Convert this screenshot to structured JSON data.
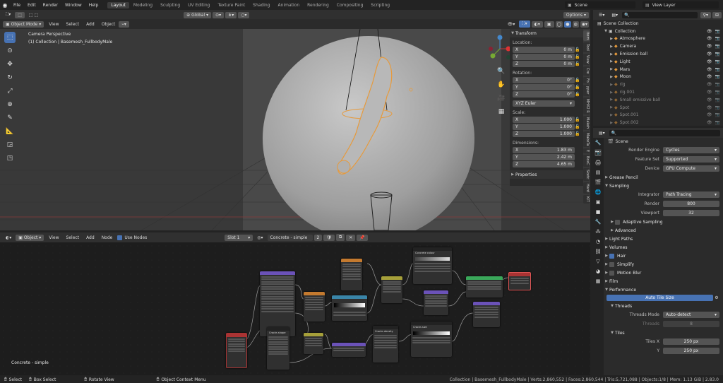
{
  "topbar": {
    "menus": [
      "File",
      "Edit",
      "Render",
      "Window",
      "Help"
    ],
    "workspaces": [
      "Layout",
      "Modeling",
      "Sculpting",
      "UV Editing",
      "Texture Paint",
      "Shading",
      "Animation",
      "Rendering",
      "Compositing",
      "Scripting"
    ],
    "active_workspace": "Layout",
    "scene": "Scene",
    "view_layer": "View Layer"
  },
  "viewport": {
    "mode": "Object Mode",
    "menus": [
      "View",
      "Select",
      "Add",
      "Object"
    ],
    "transform_orientation": "Global",
    "options": "Options",
    "overlay_title": "Camera Perspective",
    "overlay_sub": "(1) Collection | Basemesh_FullbodyMale"
  },
  "npanel": {
    "tab_header": "Transform",
    "location_label": "Location:",
    "rotation_label": "Rotation:",
    "scale_label": "Scale:",
    "dimensions_label": "Dimensions:",
    "location": [
      {
        "axis": "X",
        "value": "0 m"
      },
      {
        "axis": "Y",
        "value": "0 m"
      },
      {
        "axis": "Z",
        "value": "0 m"
      }
    ],
    "rotation": [
      {
        "axis": "X",
        "value": "0°"
      },
      {
        "axis": "Y",
        "value": "0°"
      },
      {
        "axis": "Z",
        "value": "0°"
      }
    ],
    "rotation_mode": "XYZ Euler",
    "scale": [
      {
        "axis": "X",
        "value": "1.000"
      },
      {
        "axis": "Y",
        "value": "1.000"
      },
      {
        "axis": "Z",
        "value": "1.000"
      }
    ],
    "dimensions": [
      {
        "axis": "X",
        "value": "1.83 m"
      },
      {
        "axis": "Y",
        "value": "2.42 m"
      },
      {
        "axis": "Z",
        "value": "4.65 m"
      }
    ],
    "properties": "Properties",
    "tabs": [
      "Item",
      "Tool",
      "View",
      "Cre",
      "Fo",
      "pper",
      "MHX2 R",
      "Makeh",
      "MakeTa",
      "E",
      "BoxC",
      "Sketc",
      "Hard",
      "KIT"
    ]
  },
  "node_editor": {
    "editor": "Object",
    "menus": [
      "View",
      "Select",
      "Add",
      "Node"
    ],
    "use_nodes": "Use Nodes",
    "slot": "Slot 1",
    "material": "Concrete - simple",
    "users": "2",
    "footer_label": "Concrete - simple",
    "node_titles": [
      "Concrete colour",
      "Cracks shape",
      "Cracks density",
      "Cracks size"
    ]
  },
  "outliner": {
    "root": "Scene Collection",
    "items": [
      {
        "name": "Collection",
        "color": "#c9c9c9",
        "dim": false
      },
      {
        "name": "Atmosphere",
        "color": "#e69a3c",
        "dim": false
      },
      {
        "name": "Camera",
        "color": "#e69a3c",
        "dim": false
      },
      {
        "name": "Emission ball",
        "color": "#e69a3c",
        "dim": false
      },
      {
        "name": "Light",
        "color": "#e69a3c",
        "dim": false
      },
      {
        "name": "Mars",
        "color": "#e69a3c",
        "dim": false
      },
      {
        "name": "Moon",
        "color": "#e69a3c",
        "dim": false
      },
      {
        "name": "rig",
        "color": "#e69a3c",
        "dim": true
      },
      {
        "name": "rig.001",
        "color": "#e69a3c",
        "dim": true
      },
      {
        "name": "Small emissive ball",
        "color": "#e69a3c",
        "dim": true
      },
      {
        "name": "Spot",
        "color": "#e69a3c",
        "dim": true
      },
      {
        "name": "Spot.001",
        "color": "#e69a3c",
        "dim": true
      },
      {
        "name": "Spot.002",
        "color": "#e69a3c",
        "dim": true
      }
    ]
  },
  "properties": {
    "scene": "Scene",
    "render_engine_label": "Render Engine",
    "render_engine": "Cycles",
    "feature_set_label": "Feature Set",
    "feature_set": "Supported",
    "device_label": "Device",
    "device": "GPU Compute",
    "grease_pencil": "Grease Pencil",
    "sampling": "Sampling",
    "integrator_label": "Integrator",
    "integrator": "Path Tracing",
    "render_label": "Render",
    "render_samples": "800",
    "viewport_label": "Viewport",
    "viewport_samples": "32",
    "adaptive": "Adaptive Sampling",
    "advanced": "Advanced",
    "light_paths": "Light Paths",
    "volumes": "Volumes",
    "hair": "Hair",
    "simplify": "Simplify",
    "motion_blur": "Motion Blur",
    "film": "Film",
    "performance": "Performance",
    "auto_tile": "Auto Tile Size",
    "threads": "Threads",
    "threads_mode_label": "Threads Mode",
    "threads_mode": "Auto-detect",
    "threads_label": "Threads",
    "threads_value": "8",
    "tiles": "Tiles",
    "tiles_x_label": "Tiles X",
    "tiles_x": "250 px",
    "tiles_y_label": "Y",
    "tiles_y": "250 px"
  },
  "status": {
    "select": "Select",
    "box_select": "Box Select",
    "rotate_view": "Rotate View",
    "context_menu": "Object Context Menu",
    "stats": "Collection | Basemesh_FullbodyMale | Verts:2,860,552 | Faces:2,860,544 | Tris:5,721,088 | Objects:1/8 | Mem: 1.13 GiB | 2.83.0"
  },
  "colors": {
    "accent": "#4772b3",
    "selected_outline": "#e69a3c"
  }
}
